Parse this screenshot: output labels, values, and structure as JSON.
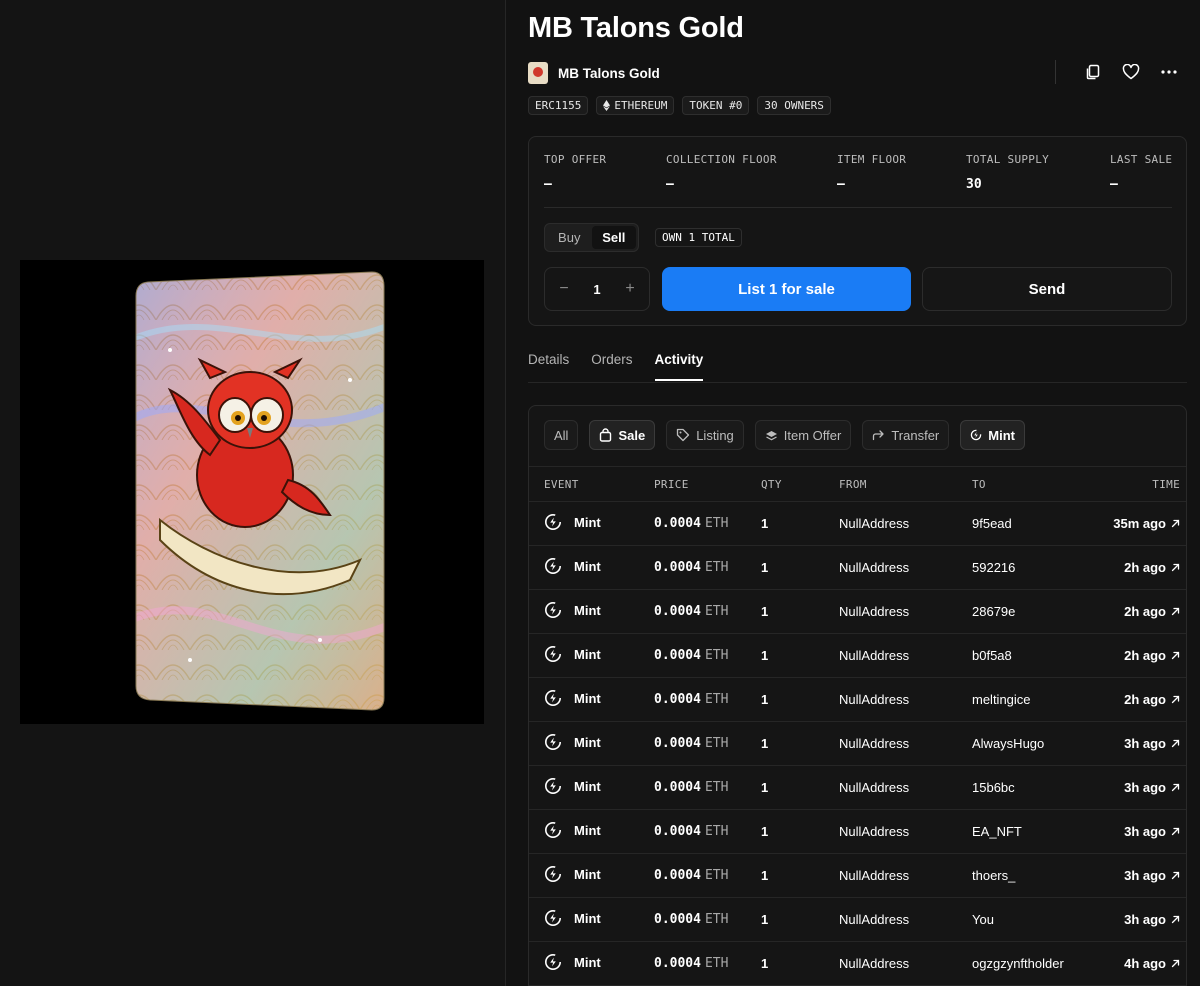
{
  "item": {
    "title": "MB Talons Gold",
    "collection_name": "MB Talons Gold"
  },
  "header_actions": {
    "icons": [
      "copy-icon",
      "heart-icon",
      "more-icon"
    ]
  },
  "tags": [
    "ERC1155",
    "ETHEREUM",
    "TOKEN #0",
    "30 OWNERS"
  ],
  "stats": [
    {
      "label": "TOP OFFER",
      "value": "–"
    },
    {
      "label": "COLLECTION FLOOR",
      "value": "–"
    },
    {
      "label": "ITEM FLOOR",
      "value": "–"
    },
    {
      "label": "TOTAL SUPPLY",
      "value": "30"
    },
    {
      "label": "LAST SALE",
      "value": "–"
    }
  ],
  "trade": {
    "buy_label": "Buy",
    "sell_label": "Sell",
    "own_label": "OWN 1 TOTAL",
    "quantity": "1",
    "minus": "−",
    "plus": "+",
    "list_label": "List 1 for sale",
    "send_label": "Send"
  },
  "tabs": [
    "Details",
    "Orders",
    "Activity"
  ],
  "filters": [
    "All",
    "Sale",
    "Listing",
    "Item Offer",
    "Transfer",
    "Mint"
  ],
  "activity_columns": [
    "EVENT",
    "PRICE",
    "QTY",
    "FROM",
    "TO",
    "TIME"
  ],
  "activity_rows": [
    {
      "event": "Mint",
      "price": "0.0004",
      "unit": "ETH",
      "qty": "1",
      "from": "NullAddress",
      "to": "9f5ead",
      "time": "35m ago"
    },
    {
      "event": "Mint",
      "price": "0.0004",
      "unit": "ETH",
      "qty": "1",
      "from": "NullAddress",
      "to": "592216",
      "time": "2h ago"
    },
    {
      "event": "Mint",
      "price": "0.0004",
      "unit": "ETH",
      "qty": "1",
      "from": "NullAddress",
      "to": "28679e",
      "time": "2h ago"
    },
    {
      "event": "Mint",
      "price": "0.0004",
      "unit": "ETH",
      "qty": "1",
      "from": "NullAddress",
      "to": "b0f5a8",
      "time": "2h ago"
    },
    {
      "event": "Mint",
      "price": "0.0004",
      "unit": "ETH",
      "qty": "1",
      "from": "NullAddress",
      "to": "meltingice",
      "time": "2h ago"
    },
    {
      "event": "Mint",
      "price": "0.0004",
      "unit": "ETH",
      "qty": "1",
      "from": "NullAddress",
      "to": "AlwaysHugo",
      "time": "3h ago"
    },
    {
      "event": "Mint",
      "price": "0.0004",
      "unit": "ETH",
      "qty": "1",
      "from": "NullAddress",
      "to": "15b6bc",
      "time": "3h ago"
    },
    {
      "event": "Mint",
      "price": "0.0004",
      "unit": "ETH",
      "qty": "1",
      "from": "NullAddress",
      "to": "EA_NFT",
      "time": "3h ago"
    },
    {
      "event": "Mint",
      "price": "0.0004",
      "unit": "ETH",
      "qty": "1",
      "from": "NullAddress",
      "to": "thoers_",
      "time": "3h ago"
    },
    {
      "event": "Mint",
      "price": "0.0004",
      "unit": "ETH",
      "qty": "1",
      "from": "NullAddress",
      "to": "You",
      "time": "3h ago"
    },
    {
      "event": "Mint",
      "price": "0.0004",
      "unit": "ETH",
      "qty": "1",
      "from": "NullAddress",
      "to": "ogzgzynftholder",
      "time": "4h ago"
    }
  ],
  "colors": {
    "background": "#121212",
    "accent": "#1a7cf5",
    "border": "#2a2a2a"
  }
}
